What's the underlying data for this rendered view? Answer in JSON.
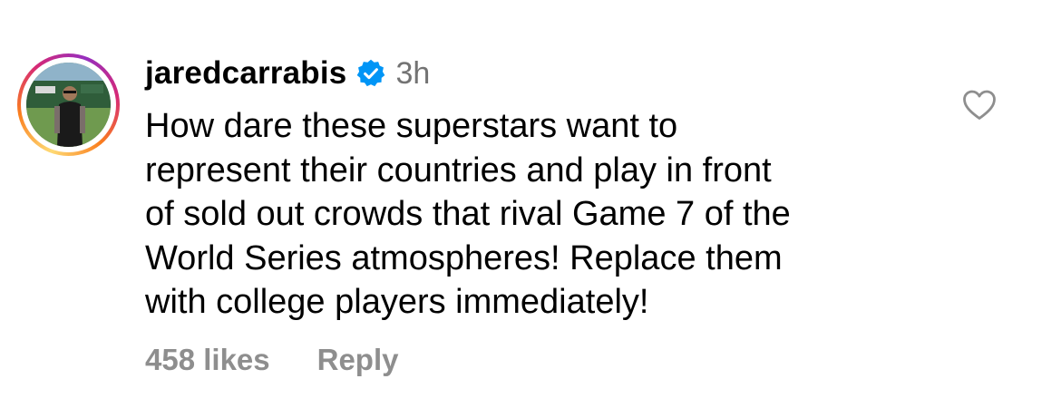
{
  "comment": {
    "username": "jaredcarrabis",
    "verified": true,
    "timestamp": "3h",
    "text": "How dare these superstars want to\nrepresent their countries and play in front\nof sold out crowds that rival Game 7 of the\nWorld Series atmospheres! Replace them\nwith college players immediately!",
    "likes_label": "458 likes",
    "reply_label": "Reply"
  },
  "icons": {
    "verified": "verified-badge-icon",
    "like": "heart-outline-icon"
  },
  "colors": {
    "text": "#000000",
    "secondary_text": "#737373",
    "footer_text": "#8e8e8e",
    "verified_blue": "#0095f6"
  }
}
